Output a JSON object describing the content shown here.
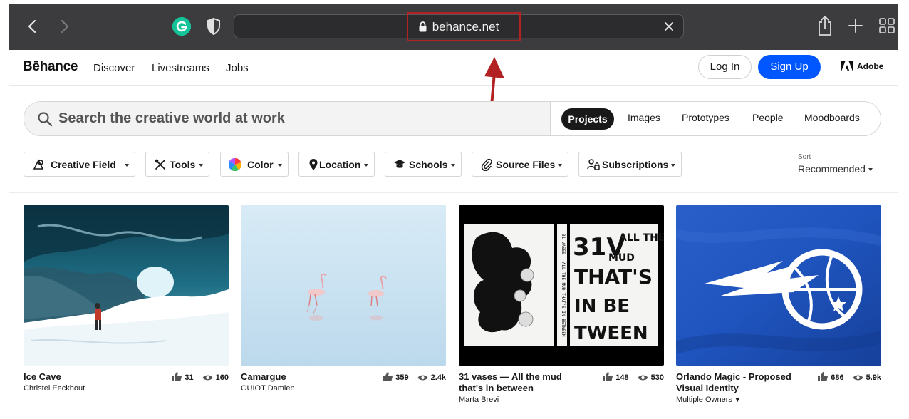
{
  "browser": {
    "url": "behance.net",
    "icons": [
      "back-icon",
      "forward-icon",
      "grammarly-icon",
      "shield-icon",
      "lock-icon",
      "clear-icon",
      "share-icon",
      "new-tab-icon",
      "tab-overview-icon"
    ]
  },
  "header": {
    "logo": "Bēhance",
    "nav": [
      "Discover",
      "Livestreams",
      "Jobs"
    ],
    "login": "Log In",
    "signup": "Sign Up",
    "adobe": "Adobe"
  },
  "search": {
    "placeholder": "Search the creative world at work",
    "segments": [
      "Projects",
      "Images",
      "Prototypes",
      "People",
      "Moodboards"
    ],
    "active": "Projects"
  },
  "filters": [
    "Creative Fields",
    "Tools",
    "Color",
    "Location",
    "Schools",
    "Source Files",
    "Subscriptions"
  ],
  "sort": {
    "label": "Sort",
    "value": "Recommended"
  },
  "cards": [
    {
      "title": "Ice Cave",
      "owner": "Christel Eeckhout",
      "likes": "31",
      "views": "160"
    },
    {
      "title": "Camargue",
      "owner": "GUIOT Damien",
      "likes": "359",
      "views": "2.4k"
    },
    {
      "title": "31 vases — All the mud that's in between",
      "owner": "Marta Brevi",
      "likes": "148",
      "views": "530"
    },
    {
      "title": "Orlando Magic - Proposed Visual Identity",
      "owner": "Multiple Owners",
      "likes": "686",
      "views": "5.9k"
    }
  ],
  "artwork": {
    "vase_poster_text": [
      "31V",
      "ALL THE",
      "MUD",
      "THAT'S",
      "IN BE",
      "TWEEN"
    ]
  },
  "colors": {
    "brand_blue": "#0057ff",
    "chrome": "#3c3c3e",
    "annotation_red": "#b22222"
  }
}
